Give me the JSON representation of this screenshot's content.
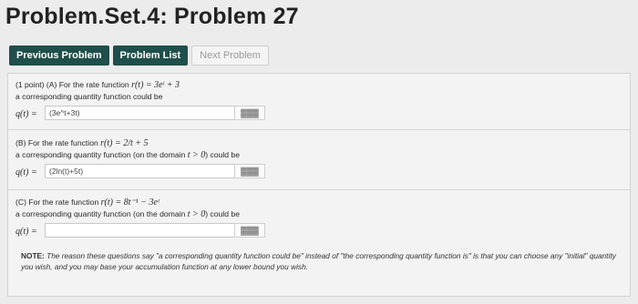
{
  "title": "Problem.Set.4: Problem 27",
  "nav": {
    "previous": "Previous Problem",
    "list": "Problem List",
    "next": "Next Problem"
  },
  "partA": {
    "prefix": "(1 point) (A) For the rate function",
    "math": "r(t) = 3eᵗ + 3",
    "line2": "a corresponding quantity function could be",
    "label": "q(t) =",
    "answer": "(3e^t+3t)",
    "preview_icon": "▓▓▓"
  },
  "partB": {
    "prefix": "(B) For the rate function",
    "math": "r(t) = 2/t + 5",
    "line2_a": "a corresponding quantity function (on the domain",
    "line2_math": "t > 0",
    "line2_b": ") could be",
    "label": "q(t) =",
    "answer": "(2ln(t)+5t)",
    "preview_icon": "▓▓▓"
  },
  "partC": {
    "prefix": "(C) For the rate function",
    "math": "r(t) = 8t⁻¹ − 3eᵗ",
    "line2_a": "a corresponding quantity function (on the domain",
    "line2_math": "t > 0",
    "line2_b": ") could be",
    "label": "q(t) =",
    "answer": "",
    "preview_icon": "▓▓▓"
  },
  "note": {
    "label": "NOTE:",
    "text": "The reason these questions say \"a corresponding quantity function could be\" instead of \"the corresponding quantity function is\" is that you can choose any \"initial\" quantity you wish, and you may base your accumulation function at any lower bound you wish."
  }
}
